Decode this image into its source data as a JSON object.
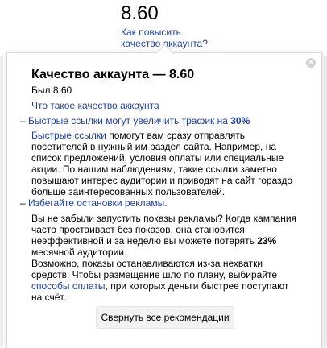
{
  "header": {
    "score": "8.60",
    "improve_link_line1": "Как повысить",
    "improve_link_line2": "качество аккаунта?"
  },
  "popup": {
    "close_glyph": "×",
    "title": "Качество аккаунта — 8.60",
    "previous": "Был 8.60",
    "what_is_link": "Что такое качество аккаунта",
    "sections": [
      {
        "heading_prefix": "Быстрые ссылки могут увеличить трафик на ",
        "heading_value": "30%",
        "para_link": "Быстрые ссылки",
        "para_text": " помогут вам сразу отправлять посетителей в нужный им раздел сайта. Например, на список предложений, условия оплаты или специальные акции. По нашим наблюдениям, такие ссылки заметно повышают интерес аудитории и приводят на сайт гораздо больше заинтересованных пользователей."
      },
      {
        "heading": "Избегайте остановки рекламы.",
        "para_text_1": "Вы не забыли запустить показы рекламы? Когда кампания часто простаивает без показов, она становится неэффективной и за неделю вы можете потерять ",
        "para_value": "23%",
        "para_text_2": " месячной аудитории.",
        "para_text_3": "Возможно, показы останавливаются из-за нехватки средств. Чтобы размещение шло по плану, выбирайте ",
        "para_link": "способы оплаты",
        "para_text_4": ", при которых деньги быстрее поступают на счёт."
      }
    ],
    "collapse_button": "Свернуть все рекомендации"
  },
  "colors": {
    "link": "#1a3dc1",
    "button_bg": "#f2f2f2",
    "close_bg": "#d2d2d2"
  }
}
